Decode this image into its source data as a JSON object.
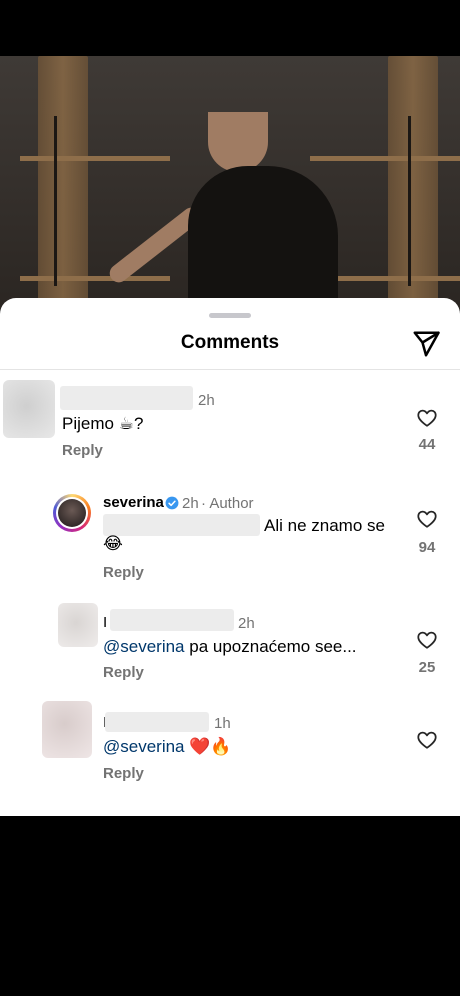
{
  "sheet": {
    "title": "Comments"
  },
  "comments": [
    {
      "time": "2h",
      "text": "Pijemo",
      "emoji": "☕",
      "suffix": "?",
      "reply": "Reply",
      "likes": "44"
    },
    {
      "username": "severina",
      "time": "2h",
      "author_tag": "· Author",
      "text": "Ali ne znamo se",
      "emoji": "😂",
      "reply": "Reply",
      "likes": "94"
    },
    {
      "initial": "I",
      "time": "2h",
      "mention": "@severina",
      "text": " pa upoznaćemo see...",
      "reply": "Reply",
      "likes": "25"
    },
    {
      "initial": "I",
      "time": "1h",
      "mention": "@severina",
      "emoji_heart": "❤️",
      "emoji_fire": "🔥",
      "reply": "Reply"
    }
  ],
  "icons": {
    "send": "send-icon",
    "like": "heart-outline-icon",
    "verified": "verified-badge-icon"
  },
  "colors": {
    "mention": "#00376b",
    "verified": "#3897f0",
    "secondary_text": "#737373"
  }
}
